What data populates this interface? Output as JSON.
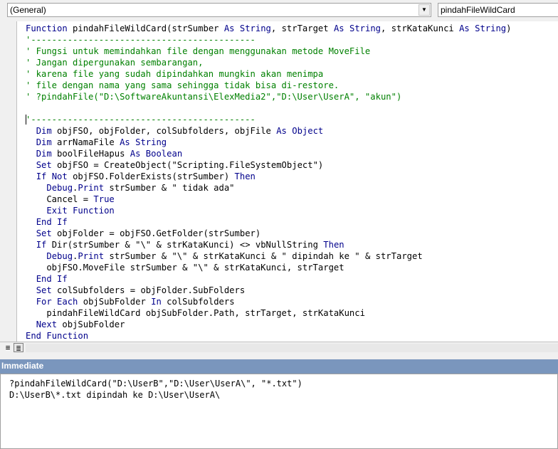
{
  "object_dropdown": {
    "value": "(General)",
    "arrow": "dropdown-arrow"
  },
  "procedure_dropdown": {
    "value": "pindahFileWildCard"
  },
  "code_lines": [
    [
      [
        "kw",
        "Function"
      ],
      [
        "t",
        " pindahFileWildCard(strSumber "
      ],
      [
        "kw",
        "As"
      ],
      [
        "t",
        " "
      ],
      [
        "kw",
        "String"
      ],
      [
        "t",
        ", strTarget "
      ],
      [
        "kw",
        "As"
      ],
      [
        "t",
        " "
      ],
      [
        "kw",
        "String"
      ],
      [
        "t",
        ", strKataKunci "
      ],
      [
        "kw",
        "As"
      ],
      [
        "t",
        " "
      ],
      [
        "kw",
        "String"
      ],
      [
        "t",
        ")"
      ]
    ],
    [
      [
        "cm",
        "'-------------------------------------------"
      ]
    ],
    [
      [
        "cm",
        "' Fungsi untuk memindahkan file dengan menggunakan metode MoveFile"
      ]
    ],
    [
      [
        "cm",
        "' Jangan dipergunakan sembarangan,"
      ]
    ],
    [
      [
        "cm",
        "' karena file yang sudah dipindahkan mungkin akan menimpa"
      ]
    ],
    [
      [
        "cm",
        "' file dengan nama yang sama sehingga tidak bisa di-restore."
      ]
    ],
    [
      [
        "cm",
        "' ?pindahFile(\"D:\\SoftwareAkuntansi\\ElexMedia2\",\"D:\\User\\UserA\", \"akun\")"
      ]
    ],
    [
      [
        "t",
        ""
      ]
    ],
    [
      [
        "cm",
        "'-------------------------------------------"
      ]
    ],
    [
      [
        "t",
        "  "
      ],
      [
        "kw",
        "Dim"
      ],
      [
        "t",
        " objFSO, objFolder, colSubfolders, objFile "
      ],
      [
        "kw",
        "As"
      ],
      [
        "t",
        " "
      ],
      [
        "kw",
        "Object"
      ]
    ],
    [
      [
        "t",
        "  "
      ],
      [
        "kw",
        "Dim"
      ],
      [
        "t",
        " arrNamaFile "
      ],
      [
        "kw",
        "As"
      ],
      [
        "t",
        " "
      ],
      [
        "kw",
        "String"
      ]
    ],
    [
      [
        "t",
        "  "
      ],
      [
        "kw",
        "Dim"
      ],
      [
        "t",
        " boolFileHapus "
      ],
      [
        "kw",
        "As"
      ],
      [
        "t",
        " "
      ],
      [
        "kw",
        "Boolean"
      ]
    ],
    [
      [
        "t",
        "  "
      ],
      [
        "kw",
        "Set"
      ],
      [
        "t",
        " objFSO = CreateObject(\"Scripting.FileSystemObject\")"
      ]
    ],
    [
      [
        "t",
        "  "
      ],
      [
        "kw",
        "If"
      ],
      [
        "t",
        " "
      ],
      [
        "kw",
        "Not"
      ],
      [
        "t",
        " objFSO.FolderExists(strSumber) "
      ],
      [
        "kw",
        "Then"
      ]
    ],
    [
      [
        "t",
        "    "
      ],
      [
        "kw",
        "Debug"
      ],
      [
        "t",
        "."
      ],
      [
        "kw",
        "Print"
      ],
      [
        "t",
        " strSumber & \" tidak ada\""
      ]
    ],
    [
      [
        "t",
        "    Cancel = "
      ],
      [
        "kw",
        "True"
      ]
    ],
    [
      [
        "t",
        "    "
      ],
      [
        "kw",
        "Exit"
      ],
      [
        "t",
        " "
      ],
      [
        "kw",
        "Function"
      ]
    ],
    [
      [
        "t",
        "  "
      ],
      [
        "kw",
        "End"
      ],
      [
        "t",
        " "
      ],
      [
        "kw",
        "If"
      ]
    ],
    [
      [
        "t",
        "  "
      ],
      [
        "kw",
        "Set"
      ],
      [
        "t",
        " objFolder = objFSO.GetFolder(strSumber)"
      ]
    ],
    [
      [
        "t",
        "  "
      ],
      [
        "kw",
        "If"
      ],
      [
        "t",
        " Dir(strSumber & \"\\\" & strKataKunci) <> vbNullString "
      ],
      [
        "kw",
        "Then"
      ]
    ],
    [
      [
        "t",
        "    "
      ],
      [
        "kw",
        "Debug"
      ],
      [
        "t",
        "."
      ],
      [
        "kw",
        "Print"
      ],
      [
        "t",
        " strSumber & \"\\\" & strKataKunci & \" dipindah ke \" & strTarget"
      ]
    ],
    [
      [
        "t",
        "    objFSO.MoveFile strSumber & \"\\\" & strKataKunci, strTarget"
      ]
    ],
    [
      [
        "t",
        "  "
      ],
      [
        "kw",
        "End"
      ],
      [
        "t",
        " "
      ],
      [
        "kw",
        "If"
      ]
    ],
    [
      [
        "t",
        "  "
      ],
      [
        "kw",
        "Set"
      ],
      [
        "t",
        " colSubfolders = objFolder.SubFolders"
      ]
    ],
    [
      [
        "t",
        "  "
      ],
      [
        "kw",
        "For"
      ],
      [
        "t",
        " "
      ],
      [
        "kw",
        "Each"
      ],
      [
        "t",
        " objSubFolder "
      ],
      [
        "kw",
        "In"
      ],
      [
        "t",
        " colSubfolders"
      ]
    ],
    [
      [
        "t",
        "    pindahFileWildCard objSubFolder.Path, strTarget, strKataKunci"
      ]
    ],
    [
      [
        "t",
        "  "
      ],
      [
        "kw",
        "Next"
      ],
      [
        "t",
        " objSubFolder"
      ]
    ],
    [
      [
        "kw",
        "End"
      ],
      [
        "t",
        " "
      ],
      [
        "kw",
        "Function"
      ]
    ]
  ],
  "view_buttons": {
    "procedure_view": "procedure-view-icon",
    "full_module_view": "full-module-view-icon"
  },
  "immediate": {
    "title": "Immediate",
    "lines": [
      "?pindahFileWildCard(\"D:\\UserB\",\"D:\\User\\UserA\\\", \"*.txt\")",
      "D:\\UserB\\*.txt dipindah ke D:\\User\\UserA\\"
    ]
  },
  "colors": {
    "keyword": "#00008b",
    "comment": "#008000",
    "immediate_title_bg": "#7a96bd"
  }
}
